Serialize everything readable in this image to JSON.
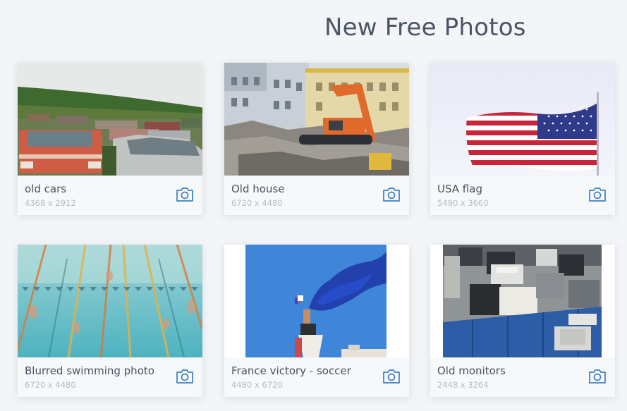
{
  "header": {
    "title": "New Free Photos"
  },
  "accent_color": "#3d7fc2",
  "photos": [
    {
      "title": "old cars",
      "dimensions": "4368 x 2912",
      "icon": "camera-icon"
    },
    {
      "title": "Old house",
      "dimensions": "6720 x 4480",
      "icon": "camera-icon"
    },
    {
      "title": "USA flag",
      "dimensions": "5490 x 3660",
      "icon": "camera-icon"
    },
    {
      "title": "Blurred swimming photo",
      "dimensions": "6720 x 4480",
      "icon": "camera-icon"
    },
    {
      "title": "France victory - soccer",
      "dimensions": "4480 x 6720",
      "icon": "camera-icon"
    },
    {
      "title": "Old monitors",
      "dimensions": "2448 x 3264",
      "icon": "camera-icon"
    }
  ]
}
